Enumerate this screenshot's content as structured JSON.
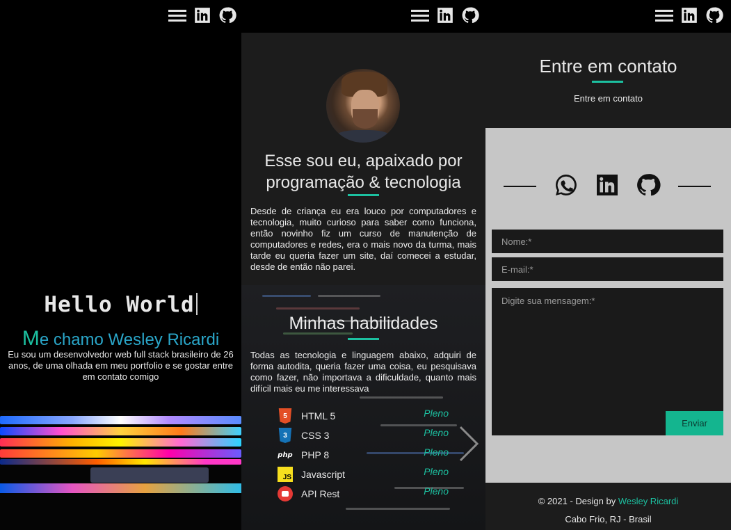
{
  "colors": {
    "accent": "#1cc0a0",
    "name_blue": "#2aa6c9",
    "panel_bg": "#1c1c1c",
    "contact_box": "#c6c6c6",
    "button": "#14b58f"
  },
  "nav": {
    "icons": [
      "menu-icon",
      "linkedin-icon",
      "github-icon"
    ]
  },
  "home": {
    "hello": "Hello World",
    "name_first_letter": "M",
    "name_rest": "e chamo Wesley Ricardi",
    "intro": "Eu sou um desenvolvedor web full stack brasileiro de 26 anos, de uma olhada em meu portfolio e se gostar entre em contato comigo"
  },
  "about": {
    "title_line1": "Esse sou eu, apaixado por",
    "title_line2": "programação & tecnologia",
    "text": "Desde de criança eu era louco por computadores e tecnologia, muito curioso para saber como funciona, então novinho fiz um curso de manutenção de computadores e redes, era o mais novo da turma, mais tarde eu queria fazer um site, daí comecei a estudar, desde de então não parei.",
    "skills_title": "Minhas habilidades",
    "skills_text": "Todas as tecnologia e linguagem abaixo, adquiri de forma autodita, queria fazer uma coisa, eu pesquisava como fazer, não importava a dificuldade, quanto mais difícil mais eu me interessava",
    "skills": [
      {
        "name": "HTML 5",
        "level": "Pleno",
        "icon": "html5-icon"
      },
      {
        "name": "CSS 3",
        "level": "Pleno",
        "icon": "css3-icon"
      },
      {
        "name": "PHP 8",
        "level": "Pleno",
        "icon": "php-icon"
      },
      {
        "name": "Javascript",
        "level": "Pleno",
        "icon": "javascript-icon"
      },
      {
        "name": "API Rest",
        "level": "Pleno",
        "icon": "api-icon"
      }
    ]
  },
  "contact": {
    "title": "Entre em contato",
    "subtitle": "Entre em contato",
    "social_icons": [
      "whatsapp-icon",
      "linkedin-icon",
      "github-icon"
    ],
    "name_placeholder": "Nome:*",
    "email_placeholder": "E-mail:*",
    "message_placeholder": "Digite sua mensagem:*",
    "send_label": "Enviar"
  },
  "footer": {
    "copyright_prefix": "© 2021 - Design by ",
    "author": "Wesley Ricardi",
    "location": "Cabo Frio, RJ - Brasil"
  }
}
